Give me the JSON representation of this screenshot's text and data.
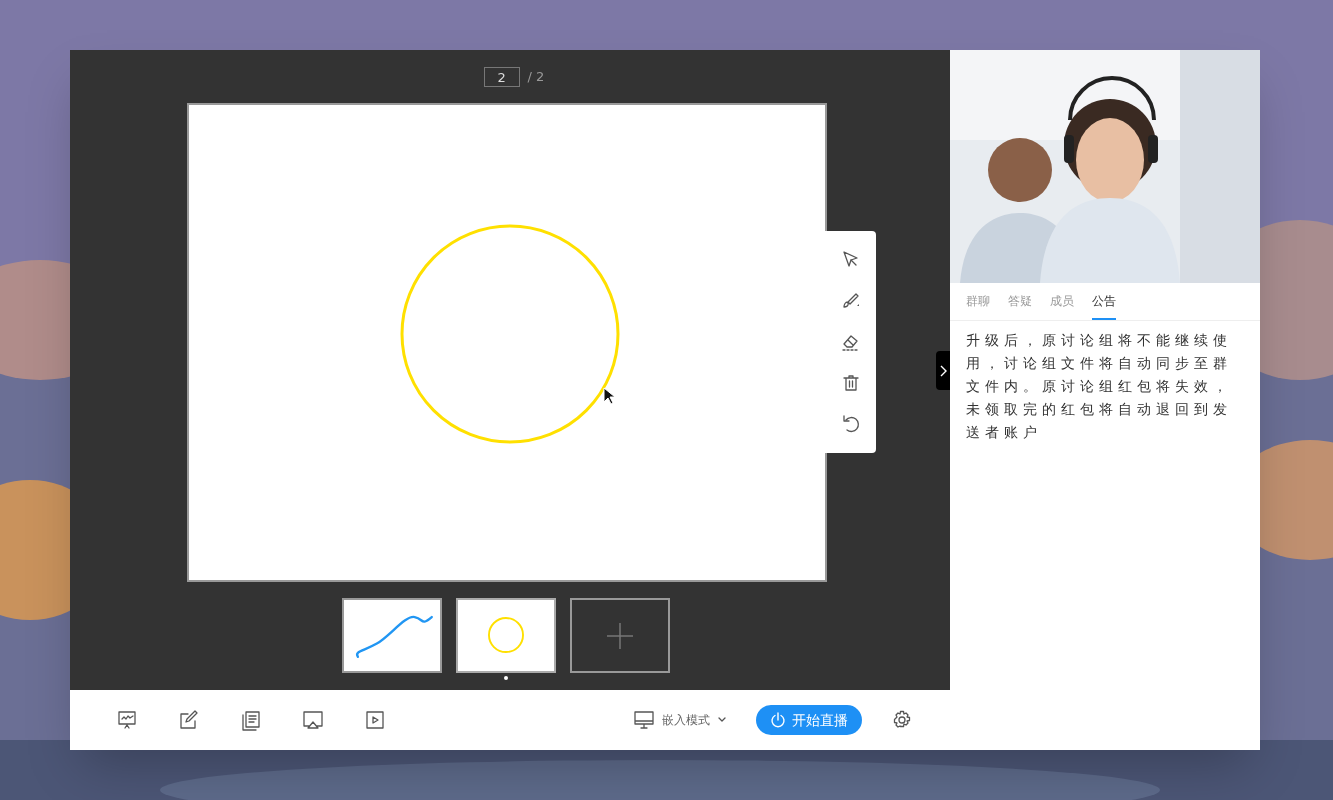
{
  "pager": {
    "value": "2",
    "total": "/ 2"
  },
  "canvas": {
    "shapes": [
      {
        "kind": "circle",
        "color": "#ffe000"
      }
    ]
  },
  "tools": [
    {
      "kind": "select"
    },
    {
      "kind": "brush"
    },
    {
      "kind": "eraser"
    },
    {
      "kind": "delete"
    },
    {
      "kind": "undo"
    }
  ],
  "slides": [
    {
      "kind": "curve",
      "selected": false
    },
    {
      "kind": "circle",
      "selected": true
    },
    {
      "kind": "add",
      "selected": false
    }
  ],
  "bottom_icons": [
    {
      "kind": "whiteboard"
    },
    {
      "kind": "edit"
    },
    {
      "kind": "docs"
    },
    {
      "kind": "cast"
    },
    {
      "kind": "play"
    }
  ],
  "mode": {
    "label": "嵌入模式"
  },
  "live_button": {
    "label": "开始直播"
  },
  "tabs": [
    {
      "label": "群聊",
      "selected": false
    },
    {
      "label": "答疑",
      "selected": false
    },
    {
      "label": "成员",
      "selected": false
    },
    {
      "label": "公告",
      "selected": true
    }
  ],
  "notice": "升级后，原讨论组将不能继续使用，讨论组文件将自动同步至群文件内。原讨论组红包将失效，未领取完的红包将自动退回到发送者账户"
}
